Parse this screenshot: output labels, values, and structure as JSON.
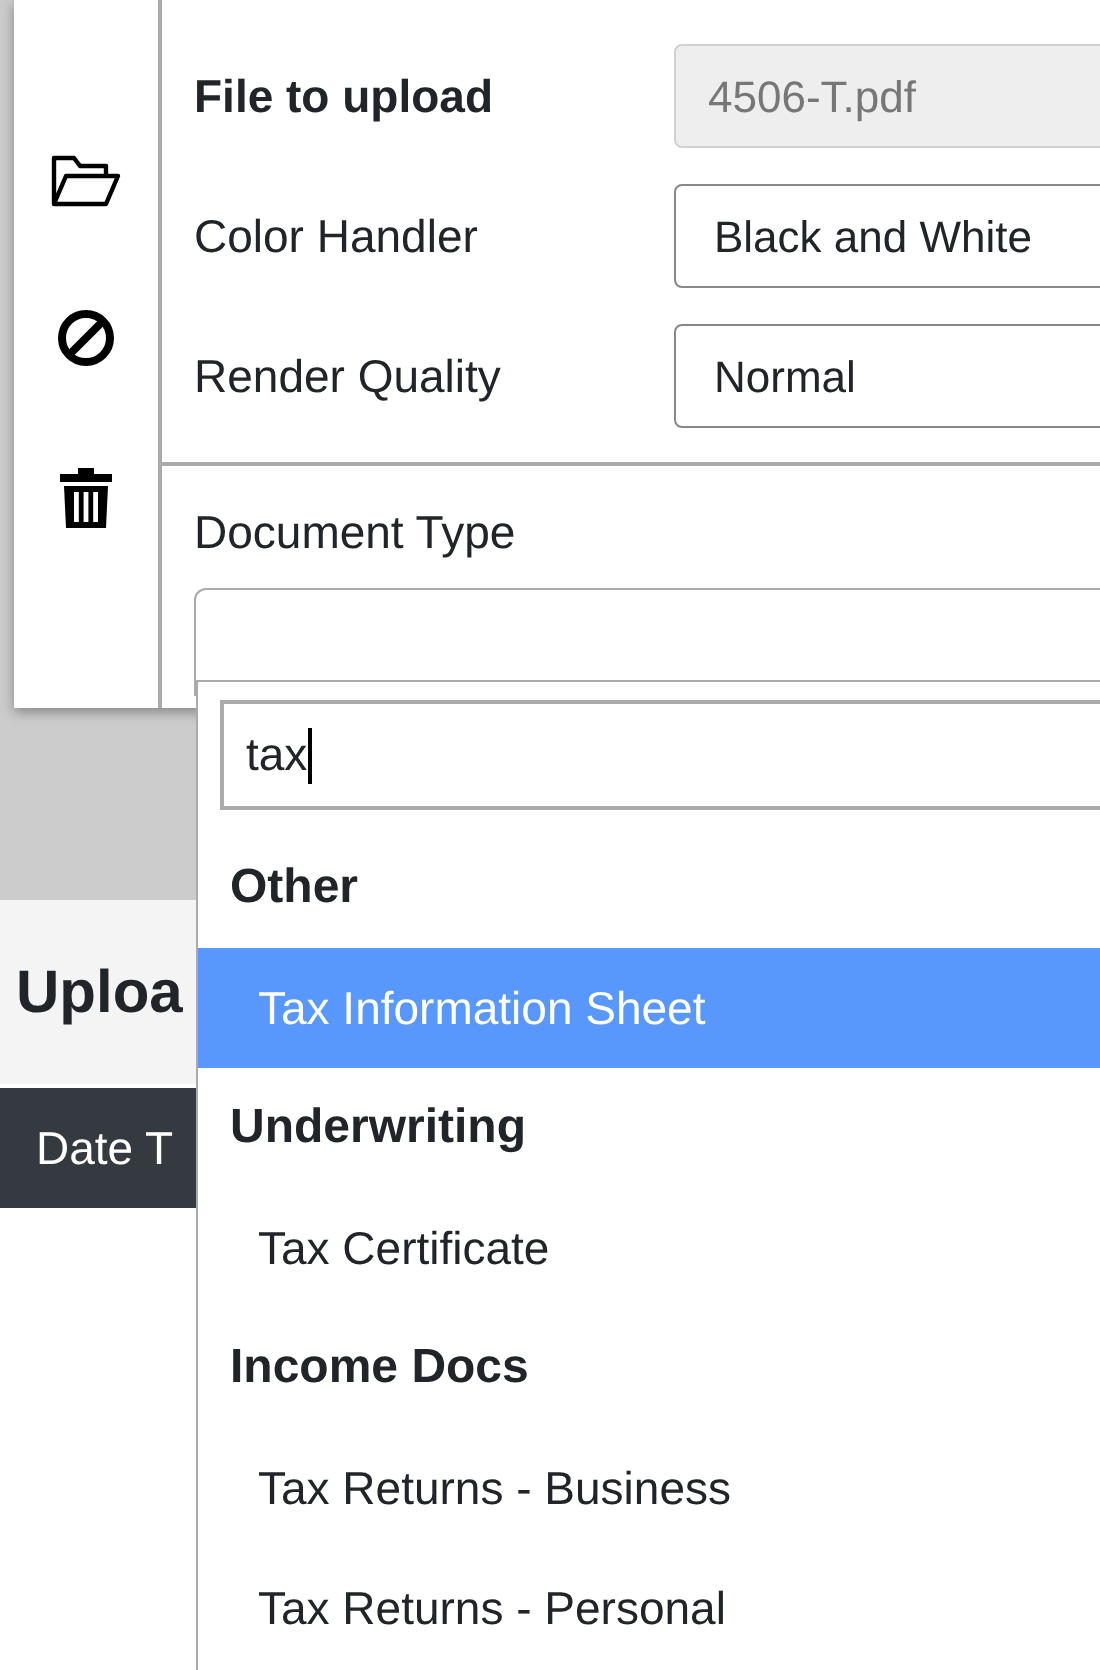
{
  "form": {
    "fields": [
      {
        "label": "File to upload",
        "kind": "file",
        "value": "4506-T.pdf"
      },
      {
        "label": "Color Handler",
        "kind": "select",
        "value": "Black and White"
      },
      {
        "label": "Render Quality",
        "kind": "select",
        "value": "Normal"
      }
    ]
  },
  "document_type": {
    "label": "Document Type",
    "dropdown": {
      "search": "tax",
      "groups": [
        {
          "label": "Other",
          "options": [
            {
              "label": "Tax Information Sheet",
              "selected": true
            }
          ]
        },
        {
          "label": "Underwriting",
          "options": [
            {
              "label": "Tax Certificate",
              "selected": false
            }
          ]
        },
        {
          "label": "Income Docs",
          "options": [
            {
              "label": "Tax Returns - Business",
              "selected": false
            },
            {
              "label": "Tax Returns - Personal",
              "selected": false
            }
          ]
        }
      ]
    }
  },
  "page": {
    "heading": "Uploa",
    "table": {
      "columns": [
        "Date T"
      ]
    }
  }
}
